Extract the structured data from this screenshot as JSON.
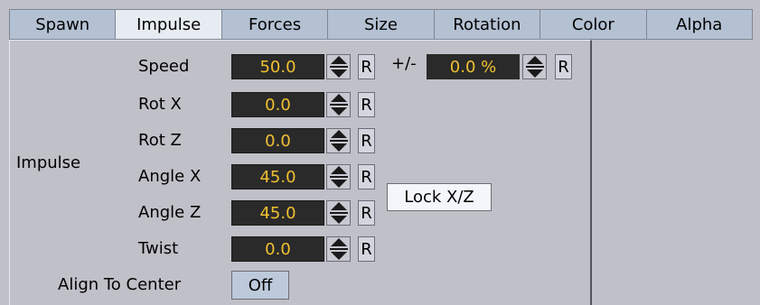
{
  "tabs": [
    {
      "label": "Spawn",
      "active": false
    },
    {
      "label": "Impulse",
      "active": true
    },
    {
      "label": "Forces",
      "active": false
    },
    {
      "label": "Size",
      "active": false
    },
    {
      "label": "Rotation",
      "active": false
    },
    {
      "label": "Color",
      "active": false
    },
    {
      "label": "Alpha",
      "active": false
    }
  ],
  "group_label": "Impulse",
  "rows": [
    {
      "label": "Speed",
      "value": "50.0",
      "reset": "R"
    },
    {
      "label": "Rot X",
      "value": "0.0",
      "reset": "R"
    },
    {
      "label": "Rot Z",
      "value": "0.0",
      "reset": "R"
    },
    {
      "label": "Angle X",
      "value": "45.0",
      "reset": "R"
    },
    {
      "label": "Angle Z",
      "value": "45.0",
      "reset": "R"
    },
    {
      "label": "Twist",
      "value": "0.0",
      "reset": "R"
    }
  ],
  "variance": {
    "label": "+/-",
    "value": "0.0 %",
    "reset": "R"
  },
  "lock_button": "Lock X/Z",
  "align": {
    "label": "Align To Center",
    "value": "Off"
  },
  "colors": {
    "field_bg": "#2a2a2a",
    "field_text": "#f0c032",
    "tab_bg": "#b4c1d3",
    "tab_active_bg": "#e7ecf2",
    "panel_bg": "#c0c0c8"
  },
  "icons": {
    "spinner": "up-down-arrows-icon"
  }
}
